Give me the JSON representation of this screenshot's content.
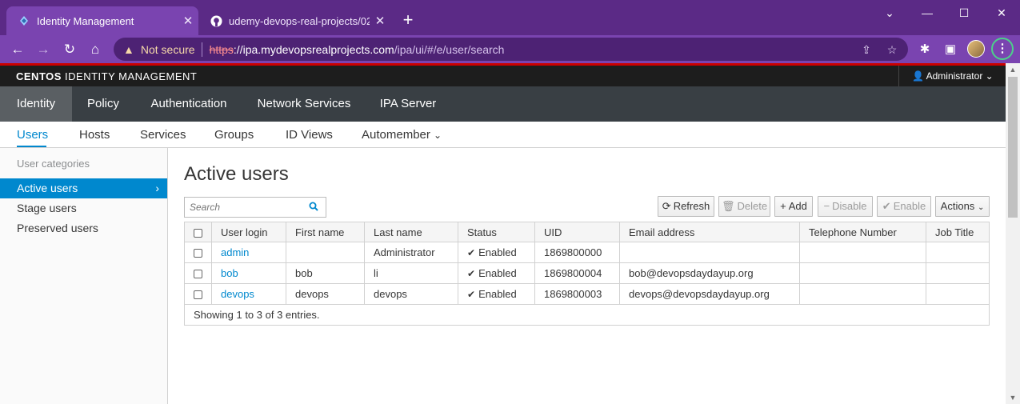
{
  "browser": {
    "tabs": [
      {
        "title": "Identity Management"
      },
      {
        "title": "udemy-devops-real-projects/02_"
      }
    ],
    "address": {
      "warning": "Not secure",
      "scheme": "https",
      "host": "://ipa.mydevopsrealprojects.com",
      "path": "/ipa/ui/#/e/user/search"
    }
  },
  "header": {
    "brand_bold": "CENTOS",
    "brand_rest": " IDENTITY MANAGEMENT",
    "user": "Administrator"
  },
  "nav_primary": [
    {
      "label": "Identity",
      "active": true
    },
    {
      "label": "Policy"
    },
    {
      "label": "Authentication"
    },
    {
      "label": "Network Services"
    },
    {
      "label": "IPA Server"
    }
  ],
  "nav_secondary": [
    {
      "label": "Users",
      "active": true
    },
    {
      "label": "Hosts"
    },
    {
      "label": "Services"
    },
    {
      "label": "Groups"
    },
    {
      "label": "ID Views"
    },
    {
      "label": "Automember"
    }
  ],
  "sidebar": {
    "category": "User categories",
    "items": [
      {
        "label": "Active users",
        "active": true
      },
      {
        "label": "Stage users"
      },
      {
        "label": "Preserved users"
      }
    ]
  },
  "main": {
    "title": "Active users",
    "search_placeholder": "Search",
    "buttons": {
      "refresh": "Refresh",
      "delete": "Delete",
      "add": "Add",
      "disable": "Disable",
      "enable": "Enable",
      "actions": "Actions"
    },
    "columns": [
      "User login",
      "First name",
      "Last name",
      "Status",
      "UID",
      "Email address",
      "Telephone Number",
      "Job Title"
    ],
    "rows": [
      {
        "login": "admin",
        "first": "",
        "last": "Administrator",
        "status": "Enabled",
        "uid": "1869800000",
        "email": "",
        "phone": "",
        "job": ""
      },
      {
        "login": "bob",
        "first": "bob",
        "last": "li",
        "status": "Enabled",
        "uid": "1869800004",
        "email": "bob@devopsdaydayup.org",
        "phone": "",
        "job": ""
      },
      {
        "login": "devops",
        "first": "devops",
        "last": "devops",
        "status": "Enabled",
        "uid": "1869800003",
        "email": "devops@devopsdaydayup.org",
        "phone": "",
        "job": ""
      }
    ],
    "footer": "Showing 1 to 3 of 3 entries."
  },
  "colors": {
    "accent": "#0088ce",
    "browser_frame": "#5b2a86",
    "brand_bar": "#1d1d1d"
  }
}
